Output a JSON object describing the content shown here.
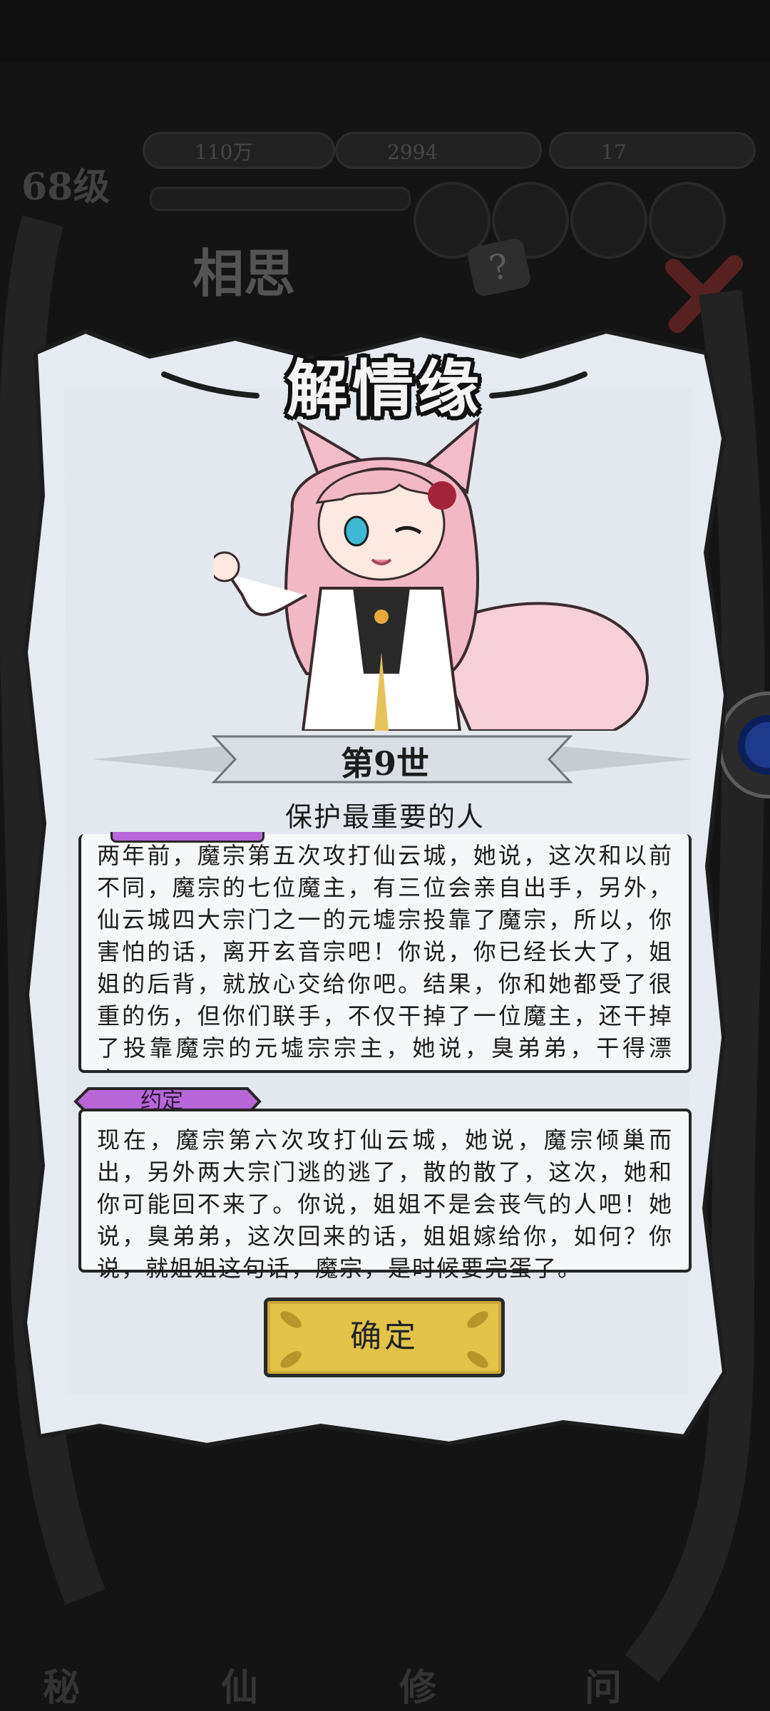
{
  "background": {
    "resources": [
      "110万",
      "2994",
      "17"
    ],
    "level": "68级",
    "panel_title": "相思",
    "help_symbol": "?",
    "bottom_tabs": [
      "秘",
      "仙",
      "修",
      "问"
    ]
  },
  "dialog": {
    "title": "解情缘",
    "life_label": "第9世",
    "subtitle": "保护最重要的人",
    "story_first": "两年前，魔宗第五次攻打仙云城，她说，这次和以前不同，魔宗的七位魔主，有三位会亲自出手，另外，仙云城四大宗门之一的元墟宗投靠了魔宗，所以，你害怕的话，离开玄音宗吧！你说，你已经长大了，姐姐的后背，就放心交给你吧。结果，你和她都受了很重的伤，但你们联手，不仅干掉了一位魔主，还干掉了投靠魔宗的元墟宗宗主，她说，臭弟弟，干得漂亮。",
    "tag_label": "约定",
    "story_second": "现在，魔宗第六次攻打仙云城，她说，魔宗倾巢而出，另外两大宗门逃的逃了，散的散了，这次，她和你可能回不来了。你说，姐姐不是会丧气的人吧！她说，臭弟弟，这次回来的话，姐姐嫁给你，如何？你说，就姐姐这句话，魔宗，是时候要完蛋了。",
    "confirm_label": "确定"
  },
  "colors": {
    "parchment": "#e6ebf1",
    "tag": "#b866d8",
    "button": "#e3c24a",
    "hair": "#f2b8c6"
  },
  "icons": [
    "question-icon",
    "close-icon",
    "side-toggle-icon",
    "fox-girl-portrait"
  ]
}
